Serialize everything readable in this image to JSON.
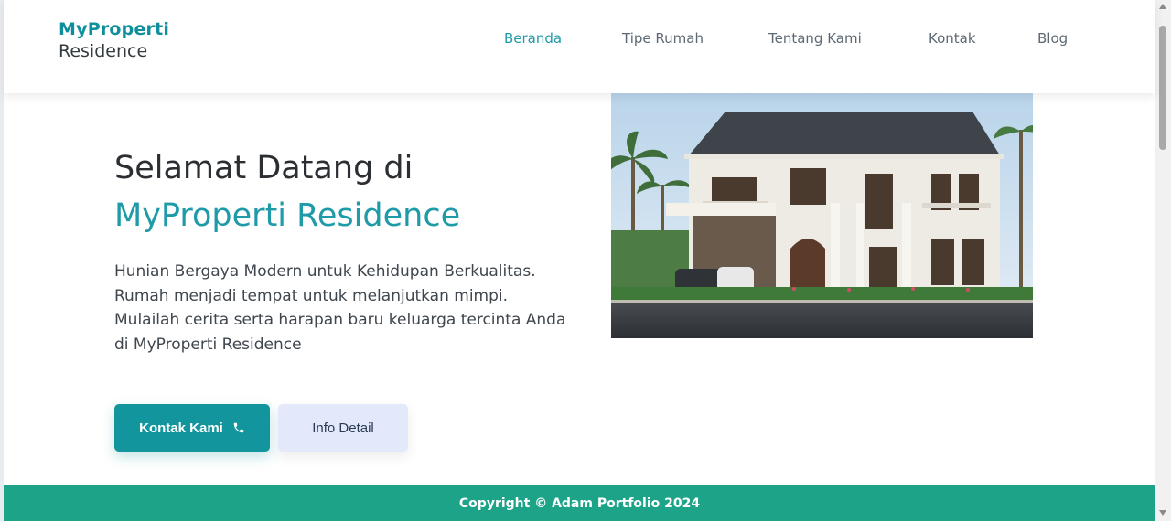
{
  "brand": {
    "line1": "MyProperti",
    "line2": "Residence",
    "color": "#0f8f9c"
  },
  "nav": {
    "items": [
      {
        "label": "Beranda",
        "active": true
      },
      {
        "label": "Tipe Rumah",
        "active": false
      },
      {
        "label": "Tentang Kami",
        "active": false
      },
      {
        "label": "Kontak",
        "active": false
      },
      {
        "label": "Blog",
        "active": false
      }
    ]
  },
  "hero": {
    "title_line1": "Selamat Datang di",
    "title_line2": "MyProperti Residence",
    "description": "Hunian Bergaya Modern untuk Kehidupan Berkualitas. Rumah menjadi tempat untuk melanjutkan mimpi. Mulailah cerita serta harapan baru keluarga tercinta Anda di MyProperti Residence",
    "primary_button": {
      "label": "Kontak Kami",
      "icon": "phone-icon"
    },
    "secondary_button": {
      "label": "Info Detail"
    },
    "image": "house-photo"
  },
  "footer": {
    "text": "Copyright © Adam Portfolio 2024"
  },
  "colors": {
    "accent": "#1f9aa8",
    "primary_button": "#12959d",
    "footer": "#1ca388",
    "secondary_button": "#e3e8fb"
  }
}
